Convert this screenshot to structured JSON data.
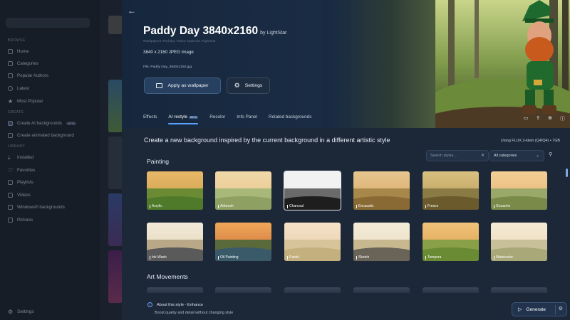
{
  "sidebar": {
    "browse_heading": "BROWSE",
    "items_browse": [
      {
        "label": "Home",
        "icon": "home-icon"
      },
      {
        "label": "Categories",
        "icon": "categories-icon"
      },
      {
        "label": "Popular Authors",
        "icon": "authors-icon"
      },
      {
        "label": "Latest",
        "icon": "clock-icon"
      },
      {
        "label": "Most Popular",
        "icon": "star-icon"
      }
    ],
    "create_heading": "CREATE",
    "items_create": [
      {
        "label": "Create AI backgrounds",
        "icon": "ai-icon",
        "badge": "BETA"
      },
      {
        "label": "Create animated background",
        "icon": "animated-icon"
      }
    ],
    "library_heading": "LIBRARY",
    "items_library": [
      {
        "label": "Installed",
        "icon": "download-icon"
      },
      {
        "label": "Favorites",
        "icon": "heart-icon"
      },
      {
        "label": "Playlists",
        "icon": "playlist-icon"
      },
      {
        "label": "Videos",
        "icon": "video-icon"
      },
      {
        "label": "Windows® backgrounds",
        "icon": "windows-icon"
      },
      {
        "label": "Pictures",
        "icon": "pictures-icon"
      }
    ],
    "settings_label": "Settings"
  },
  "header": {
    "title": "Paddy Day 3840x2160",
    "author": "by LightStar",
    "tags": "#wallpapers  #holiday  #saint  #patricks  #lightstar",
    "image_type": "3840 x 2160 JPEG Image",
    "file_name": "File: Paddy Day_3840x2160.jpg",
    "apply_label": "Apply as wallpaper",
    "settings_label": "Settings"
  },
  "tabs": [
    {
      "label": "Effects"
    },
    {
      "label": "AI restyle",
      "badge": "BETA",
      "active": true
    },
    {
      "label": "Recolor"
    },
    {
      "label": "Info Panel"
    },
    {
      "label": "Related backgrounds"
    }
  ],
  "restyle": {
    "headline": "Create a new background inspired by the current background in a different artistic style",
    "using": "Using FLUX.2-klein (Q4/Q4)  •  7GB",
    "search_placeholder": "Search styles...",
    "category_value": "All categories",
    "section_painting": "Painting",
    "painting_styles": [
      "Acrylic",
      "Airbrush",
      "Charcoal",
      "Encaustic",
      "Fresco",
      "Gouache",
      "Ink Wash",
      "Oil Painting",
      "Pastel",
      "Sketch",
      "Tempera",
      "Watercolor"
    ],
    "section_art_movements": "Art Movements",
    "about_title": "About this style - Enhance",
    "about_text": "Boost quality and detail without changing style",
    "generate_label": "Generate"
  },
  "colors": {
    "accent": "#5aa2ff",
    "panel_bg": "#1c2738",
    "sidebar_bg": "#171d26"
  }
}
